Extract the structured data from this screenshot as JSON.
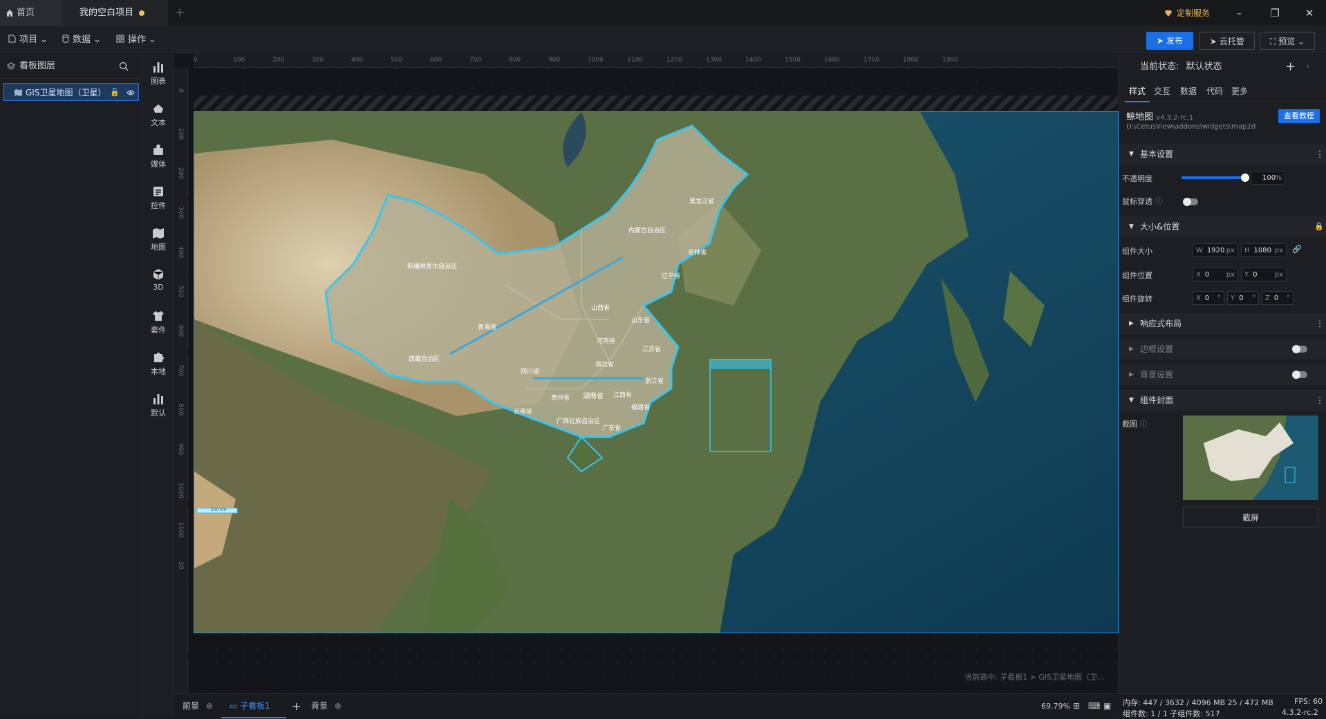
{
  "titlebar": {
    "home_tab": "首页",
    "project_tab": "我的空白项目",
    "custom_service": "定制服务"
  },
  "menubar": {
    "project": "项目",
    "data": "数据",
    "operate": "操作",
    "publish": "发布",
    "cloud": "云托管",
    "preview": "预览"
  },
  "layers": {
    "title": "看板图层",
    "items": [
      {
        "label": "GIS卫星地图（卫星）"
      }
    ]
  },
  "toolbar": {
    "items": [
      "图表",
      "文本",
      "媒体",
      "控件",
      "地图",
      "3D",
      "套件",
      "本地",
      "默认"
    ]
  },
  "ruler": {
    "h_ticks": [
      "0",
      "100",
      "200",
      "300",
      "400",
      "500",
      "600",
      "700",
      "800",
      "900",
      "1000",
      "1100",
      "1200",
      "1300",
      "1400",
      "1500",
      "1600",
      "1700",
      "1800",
      "1900"
    ],
    "v_ticks": [
      "0",
      "100",
      "200",
      "300",
      "400",
      "500",
      "600",
      "700",
      "800",
      "900",
      "1000",
      "1100",
      "20"
    ]
  },
  "map": {
    "provinces": [
      "黑龙江省",
      "内蒙古自治区",
      "吉林省",
      "辽宁省",
      "新疆维吾尔自治区",
      "山西省",
      "山东省",
      "青海省",
      "河南省",
      "江苏省",
      "西藏自治区",
      "四川省",
      "湖北省",
      "浙江省",
      "湖南省",
      "江西省",
      "贵州省",
      "福建省",
      "云南省",
      "广西壮族自治区",
      "广东省"
    ],
    "scale_label": "500 km",
    "colors": {
      "border": "#35c6f2",
      "ocean": "#1c5a73",
      "land_light": "#cdbf9f",
      "land_dark": "#3b5a34"
    }
  },
  "canvas": {
    "selection_hint": "当前选中: 子看板1 > GIS卫星地图（卫..."
  },
  "bottombar": {
    "front": "前景",
    "sub_board": "子看板1",
    "background": "背景",
    "zoom": "69.79%"
  },
  "rightpanel": {
    "state_label": "当前状态:",
    "state_value": "默认状态",
    "tabs": [
      "样式",
      "交互",
      "数据",
      "代码",
      "更多"
    ],
    "widget_name": "鲸地图",
    "widget_version": "v4.3.2-rc.1",
    "widget_path": "D:\\CetusView\\addons\\widgets\\map2d",
    "tutorial_btn": "查看教程",
    "basic_settings": "基本设置",
    "opacity_label": "不透明度",
    "opacity_value": "100",
    "opacity_unit": "%",
    "opacity_level": 1.0,
    "mouse_through_label": "鼠标穿透",
    "size_pos_section": "大小&位置",
    "size_label": "组件大小",
    "w_prefix": "W",
    "w_value": "1920",
    "h_prefix": "H",
    "h_value": "1080",
    "px": "px",
    "pos_label": "组件位置",
    "x_prefix": "X",
    "x_value": "0",
    "y_prefix": "Y",
    "y_value": "0",
    "rotate_label": "组件旋转",
    "z_prefix": "Z",
    "rot_x": "0",
    "rot_y": "0",
    "rot_z": "0",
    "deg": "°",
    "responsive": "响应式布局",
    "border": "边框设置",
    "bg": "背景设置",
    "cover": "组件封面",
    "screenshot_label": "截图",
    "capture_btn": "截屏"
  },
  "statusbar": {
    "mem": "内存:  447 / 3632 / 4096 MB  25 / 472 MB",
    "fps": "FPS:  60",
    "count": "组件数: 1 / 1   子组件数: 517",
    "version": "4.3.2-rc.2"
  }
}
